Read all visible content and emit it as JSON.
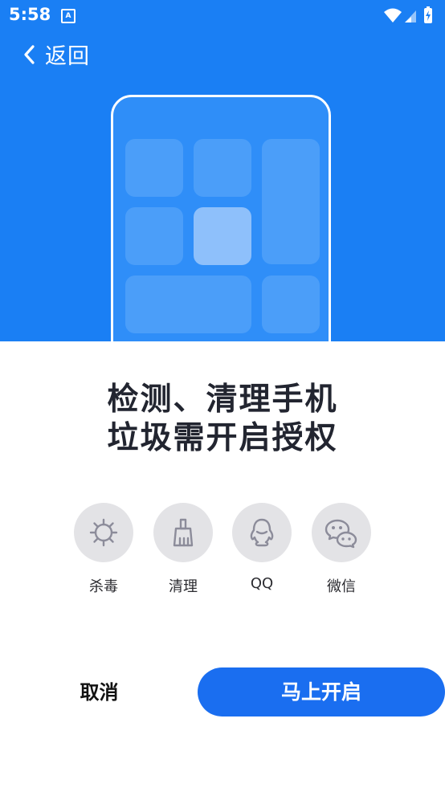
{
  "status_bar": {
    "time": "5:58",
    "notification_letter": "A"
  },
  "header": {
    "back_label": "返回"
  },
  "hero": {
    "title_line1": "检测、清理手机",
    "title_line2": "垃圾需开启授权"
  },
  "features": [
    {
      "label": "杀毒",
      "icon": "virus-icon"
    },
    {
      "label": "清理",
      "icon": "broom-icon"
    },
    {
      "label": "QQ",
      "icon": "qq-penguin-icon"
    },
    {
      "label": "微信",
      "icon": "wechat-icon"
    }
  ],
  "actions": {
    "cancel_label": "取消",
    "enable_label": "马上开启"
  },
  "colors": {
    "hero_blue": "#1a7ff4",
    "button_blue": "#1a6ef0",
    "icon_circle": "#e3e3e6",
    "icon_stroke": "#8c8c9a"
  }
}
